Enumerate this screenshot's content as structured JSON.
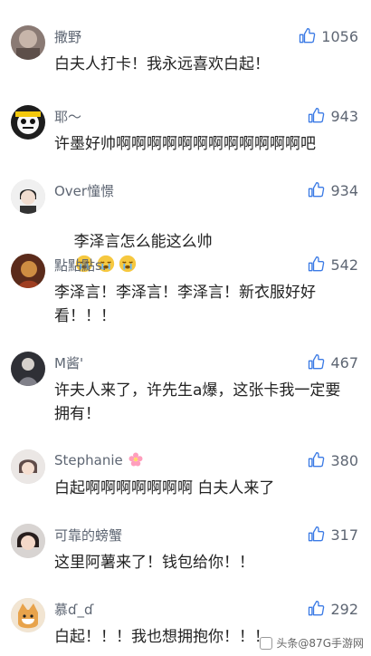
{
  "comments": [
    {
      "user": "撒野",
      "likes": "1056",
      "text": "白夫人打卡！我永远喜欢白起！"
    },
    {
      "user": "耶～",
      "likes": "943",
      "text": "许墨好帅啊啊啊啊啊啊啊啊啊啊啊啊吧"
    },
    {
      "user": "Over憧憬",
      "likes": "934",
      "text": "李泽言怎么能这么帅"
    },
    {
      "user": "點點點s.",
      "likes": "542",
      "text": "李泽言！李泽言！李泽言！新衣服好好看！！！"
    },
    {
      "user": "M酱'",
      "likes": "467",
      "text": "许夫人来了，许先生a爆，这张卡我一定要拥有！"
    },
    {
      "user": "Stephanie",
      "likes": "380",
      "text": "白起啊啊啊啊啊啊啊 白夫人来了"
    },
    {
      "user": "可靠的螃蟹",
      "likes": "317",
      "text": "这里阿薯来了！钱包给你！！"
    },
    {
      "user": "慕ɗ_ɗ",
      "likes": "292",
      "text": "白起！！！我也想拥抱你！！！"
    }
  ],
  "watermark": "头条@87G手游网",
  "icons": {
    "like": "thumbs-up-icon",
    "crying_emoji": "crying-face-icon",
    "flower": "flower-icon"
  },
  "colors": {
    "text": "#222222",
    "meta": "#5e6673",
    "icon": "#3c7be5"
  }
}
